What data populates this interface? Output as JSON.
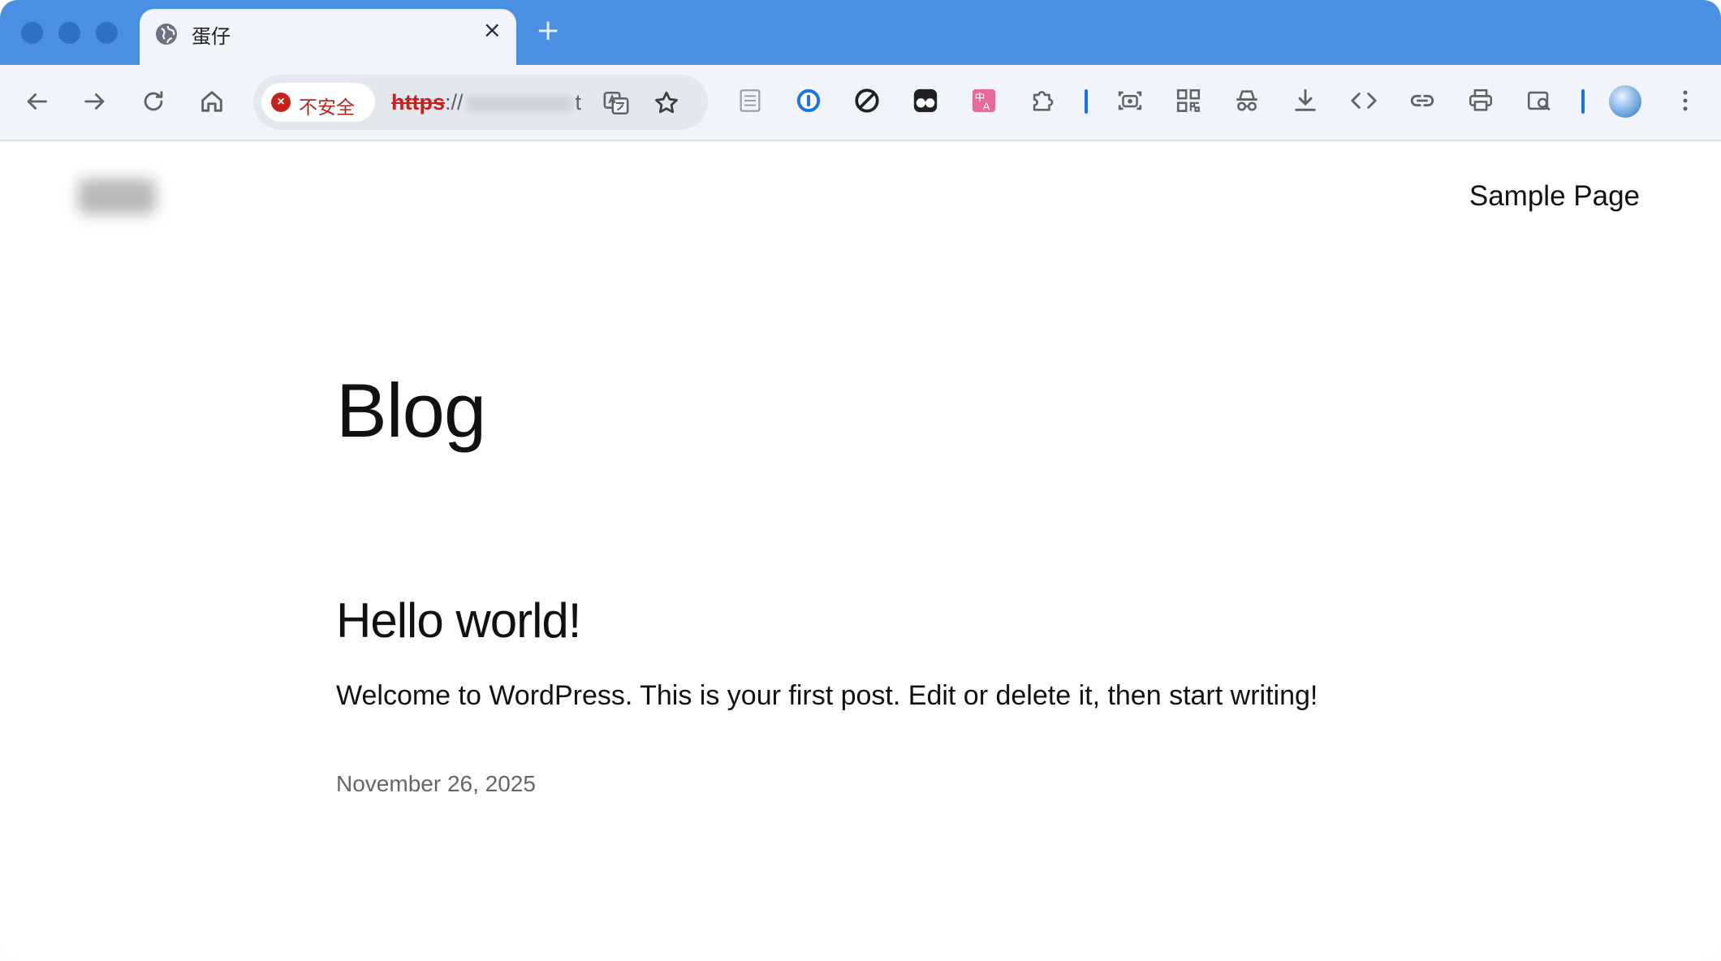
{
  "browser": {
    "tab": {
      "title": "蛋仔",
      "close_icon": "×",
      "favicon": "globe-icon"
    },
    "new_tab_label": "+",
    "omnibox": {
      "security_label": "不安全",
      "url_scheme": "https",
      "url_separator": "://",
      "url_tail": "t"
    },
    "colors": {
      "tabstrip": "#4a90e2",
      "toolbar": "#f1f5fb",
      "insecure": "#c5221f",
      "divider": "#1a73e8"
    }
  },
  "site": {
    "nav_link": "Sample Page",
    "blog_title": "Blog",
    "post": {
      "title": "Hello world!",
      "excerpt": "Welcome to WordPress. This is your first post. Edit or delete it, then start writing!",
      "date": "November 26, 2025"
    }
  }
}
